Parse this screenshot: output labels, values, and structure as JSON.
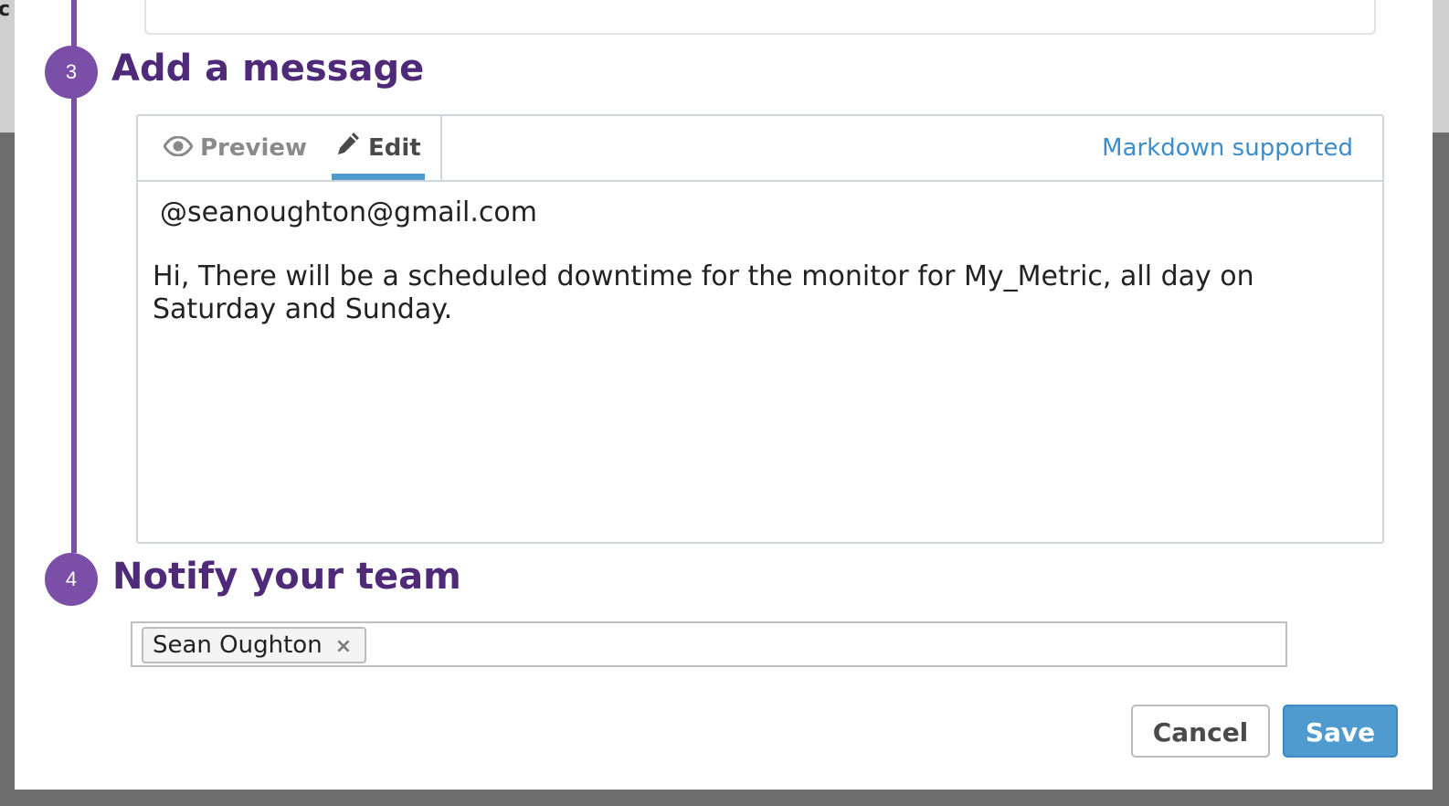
{
  "backdrop": {
    "left_peek_text": "c"
  },
  "steps": [
    {
      "number": "3",
      "title": "Add a message"
    },
    {
      "number": "4",
      "title": "Notify your team"
    }
  ],
  "editor": {
    "tabs": [
      {
        "label": "Preview",
        "icon": "eye-icon",
        "active": false
      },
      {
        "label": "Edit",
        "icon": "pencil-icon",
        "active": true
      }
    ],
    "markdown_link": "Markdown supported",
    "message_lines": [
      "@seanoughton@gmail.com",
      "Hi, There will be a scheduled downtime for the monitor for My_Metric, all day on Saturday and Sunday."
    ]
  },
  "notify": {
    "recipients": [
      {
        "name": "Sean Oughton",
        "remove_glyph": "×"
      }
    ]
  },
  "buttons": {
    "cancel": "Cancel",
    "save": "Save"
  },
  "colors": {
    "accent_purple": "#7b4fa7",
    "heading_purple": "#4e2a78",
    "primary_blue": "#4f9bd0",
    "link_blue": "#3c8dc9"
  }
}
